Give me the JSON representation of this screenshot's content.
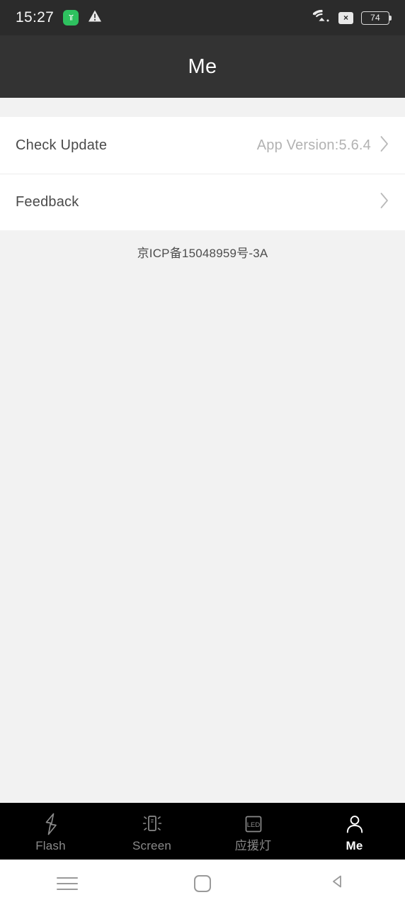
{
  "status_bar": {
    "time": "15:27",
    "app_badge_icon": "green-app-badge-icon",
    "warning_icon": "warning-triangle-icon",
    "wifi_icon": "wifi-icon",
    "no_sim_label": "×",
    "battery_level": "74",
    "background_color": "#2b2b2b"
  },
  "header": {
    "title": "Me",
    "background_color": "#333333",
    "text_color": "#ffffff"
  },
  "main": {
    "rows": [
      {
        "label": "Check Update",
        "value": "App Version:5.6.4",
        "chevron_icon": "chevron-right-icon"
      },
      {
        "label": "Feedback",
        "value": "",
        "chevron_icon": "chevron-right-icon"
      }
    ],
    "icp_license": "京ICP备15048959号-3A",
    "background_color": "#f2f2f2",
    "card_color": "#ffffff"
  },
  "tab_bar": {
    "background_color": "#000000",
    "active_color": "#ffffff",
    "inactive_color": "#8a8a8a",
    "tabs": [
      {
        "label": "Flash",
        "icon": "lightning-bolt-icon",
        "active": false
      },
      {
        "label": "Screen",
        "icon": "glowing-phone-icon",
        "active": false
      },
      {
        "label": "应援灯",
        "icon": "led-box-icon",
        "active": false
      },
      {
        "label": "Me",
        "icon": "person-icon",
        "active": true
      }
    ],
    "led_icon_text": "LED"
  },
  "nav_bar": {
    "background_color": "#ffffff",
    "buttons": [
      {
        "name": "recents",
        "icon": "hamburger-recents-icon"
      },
      {
        "name": "home",
        "icon": "square-home-icon"
      },
      {
        "name": "back",
        "icon": "triangle-back-icon"
      }
    ]
  }
}
